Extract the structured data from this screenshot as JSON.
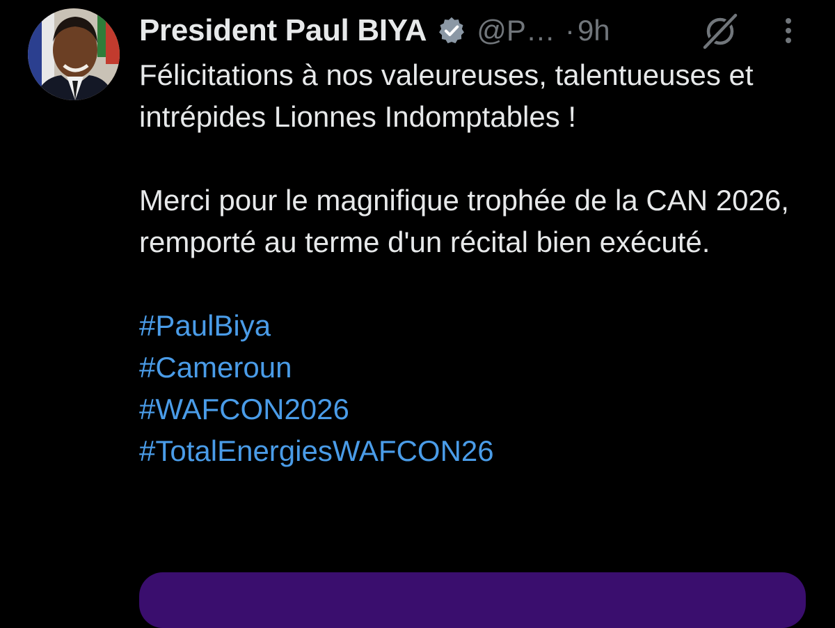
{
  "tweet": {
    "author_name": "President Paul BIYA",
    "handle": "@P…",
    "separator": "·",
    "timestamp": "9h",
    "paragraphs": [
      "Félicitations à nos valeureuses, talentueuses et intrépides Lionnes Indomptables !",
      "Merci pour le magnifique trophée de la CAN 2026, remporté au terme d'un récital bien exécuté."
    ],
    "hashtags": [
      "#PaulBiya",
      "#Cameroun",
      "#WAFCON2026",
      "#TotalEnergiesWAFCON26"
    ]
  },
  "icons": {
    "verified": "verified-badge-icon",
    "grok": "grok-icon",
    "more": "more-options-icon"
  },
  "colors": {
    "background": "#000000",
    "text": "#e7e9ea",
    "muted": "#71767b",
    "link": "#4a9ce8",
    "media_card": "#3a0e6e"
  }
}
